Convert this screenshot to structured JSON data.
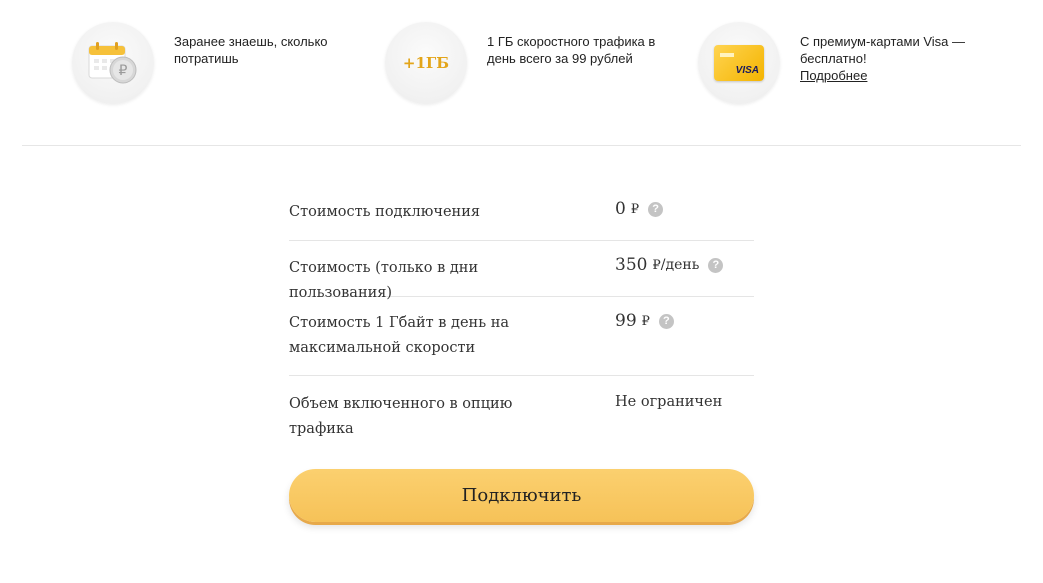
{
  "features": [
    {
      "icon": "calendar-coin-icon",
      "text": "Заранее знаешь, сколько потратишь",
      "link": null
    },
    {
      "icon": "plus-1gb-icon",
      "icon_text": "+1ГБ",
      "text": "1 ГБ скоростного трафика в день всего за 99 рублей",
      "link": null
    },
    {
      "icon": "visa-card-icon",
      "icon_text": "VISA",
      "text": "С премиум-картами Visa — бесплатно!",
      "link": "Подробнее"
    }
  ],
  "tariff": {
    "rows": [
      {
        "label": "Стоимость подключения",
        "value": "0",
        "currency": "₽",
        "unit": "",
        "help": "?"
      },
      {
        "label": "Стоимость (только в дни пользования)",
        "value": "350",
        "currency": "₽",
        "unit": "/день",
        "help": "?"
      },
      {
        "label": "Стоимость 1 Гбайт в день на максимальной скорости",
        "value": "99",
        "currency": "₽",
        "unit": "",
        "help": "?"
      },
      {
        "label": "Объем включенного в опцию трафика",
        "value": "Не ограничен"
      }
    ]
  },
  "cta": {
    "label": "Подключить"
  },
  "colors": {
    "accent": "#f6c258",
    "help": "#c4c4c4",
    "divider": "#e6e6e6"
  }
}
